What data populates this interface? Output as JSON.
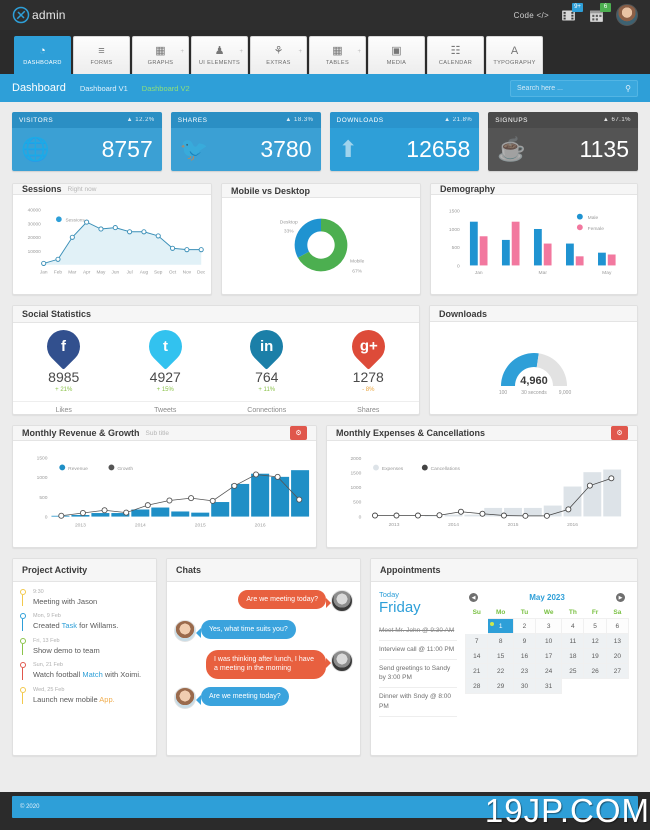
{
  "topbar": {
    "brand": "admin",
    "code_label": "Code </>",
    "video_badge": "9+",
    "calendar_badge": "6",
    "video_icon": "film-icon",
    "calendar_icon": "calendar-icon",
    "avatar_icon": "user-avatar"
  },
  "nav": {
    "tabs": [
      {
        "label": "DASHBOARD",
        "icon": "speedometer-icon",
        "active": true,
        "plus": false
      },
      {
        "label": "FORMS",
        "icon": "list-icon",
        "active": false,
        "plus": false
      },
      {
        "label": "GRAPHS",
        "icon": "bar-chart-icon",
        "active": false,
        "plus": true
      },
      {
        "label": "UI ELEMENTS",
        "icon": "cube-icon",
        "active": false,
        "plus": true
      },
      {
        "label": "EXTRAS",
        "icon": "puzzle-icon",
        "active": false,
        "plus": true
      },
      {
        "label": "TABLES",
        "icon": "table-icon",
        "active": false,
        "plus": true
      },
      {
        "label": "MEDIA",
        "icon": "image-icon",
        "active": false,
        "plus": false
      },
      {
        "label": "CALENDAR",
        "icon": "calendar-icon",
        "active": false,
        "plus": false
      },
      {
        "label": "TYPOGRAPHY",
        "icon": "letter-a-icon",
        "active": false,
        "plus": false
      }
    ]
  },
  "breadcrumb": {
    "title": "Dashboard",
    "items": [
      {
        "label": "Dashboard V1",
        "current": false
      },
      {
        "label": "Dashboard V2",
        "current": true
      }
    ]
  },
  "search": {
    "placeholder": "Search here ...",
    "value": ""
  },
  "stats": [
    {
      "label": "VISITORS",
      "pct": "12.2%",
      "value": "8757",
      "icon": "globe-icon",
      "theme": "blue"
    },
    {
      "label": "SHARES",
      "pct": "18.3%",
      "value": "3780",
      "icon": "twitter-icon",
      "theme": "blue"
    },
    {
      "label": "DOWNLOADS",
      "pct": "21.8%",
      "value": "12658",
      "icon": "upload-icon",
      "theme": "lightblue"
    },
    {
      "label": "SIGNUPS",
      "pct": "67.1%",
      "value": "1135",
      "icon": "coffee-icon",
      "theme": "dark"
    }
  ],
  "panels": {
    "sessions": {
      "title": "Sessions",
      "subtitle": "Right now"
    },
    "mobile_desktop": {
      "title": "Mobile vs Desktop"
    },
    "demography": {
      "title": "Demography"
    },
    "social": {
      "title": "Social Statistics"
    },
    "downloads": {
      "title": "Downloads"
    },
    "revenue": {
      "title": "Monthly Revenue & Growth",
      "subtitle": "Sub title",
      "button_icon": "gear-icon"
    },
    "expenses": {
      "title": "Monthly Expenses & Cancellations",
      "button_icon": "gear-icon"
    },
    "activity": {
      "title": "Project Activity"
    },
    "chats": {
      "title": "Chats"
    },
    "appointments": {
      "title": "Appointments"
    }
  },
  "chart_data": [
    {
      "type": "area",
      "title": "Sessions",
      "subtitle": "Right now",
      "categories": [
        "Jan",
        "Feb",
        "Mar",
        "Apr",
        "May",
        "Jun",
        "Jul",
        "Aug",
        "Sep",
        "Oct",
        "Nov",
        "Dec"
      ],
      "series": [
        {
          "name": "Sessions",
          "values": [
            1000,
            4000,
            20000,
            31000,
            26000,
            27000,
            24000,
            24000,
            21000,
            12000,
            11000,
            11000
          ],
          "color": "#3a8fb7"
        }
      ],
      "ylim": [
        0,
        40000
      ],
      "yticks": [
        10000,
        20000,
        30000,
        40000
      ],
      "xlabel": "",
      "ylabel": "",
      "grid": false,
      "legend": "inside-top-left"
    },
    {
      "type": "pie",
      "title": "Mobile vs Desktop",
      "labels": [
        "Mobile",
        "Desktop"
      ],
      "values": [
        67,
        33
      ],
      "value_labels": [
        "67%",
        "33%"
      ],
      "colors": [
        "#4caf50",
        "#1f93d1"
      ],
      "donut": true,
      "legend": "callout-labels"
    },
    {
      "type": "bar",
      "title": "Demography",
      "categories": [
        "Jan",
        "",
        "Mar",
        "",
        "May"
      ],
      "series": [
        {
          "name": "Male",
          "values": [
            1200,
            700,
            1000,
            600,
            350
          ],
          "color": "#1f93d1"
        },
        {
          "name": "Female",
          "values": [
            800,
            1200,
            600,
            250,
            300
          ],
          "color": "#f2789f"
        }
      ],
      "ylim": [
        0,
        1500
      ],
      "yticks": [
        0,
        500,
        1000,
        1500
      ],
      "xlabel": "",
      "ylabel": "",
      "grid": false,
      "legend": "top-right"
    },
    {
      "type": "gauge",
      "title": "Downloads",
      "value": 4960,
      "value_label": "4,960",
      "min_label": "100",
      "center_label": "30 seconds",
      "max_label": "9,000",
      "ylim": [
        100,
        9000
      ],
      "colors": [
        "#2e9fd8",
        "#e2e2e2"
      ]
    },
    {
      "type": "bar",
      "title": "Monthly Revenue & Growth",
      "subtitle": "Sub title",
      "categories": [
        "2013",
        "",
        "",
        "2014",
        "",
        "",
        "2015",
        "",
        "",
        "2016",
        "",
        ""
      ],
      "series": [
        {
          "name": "Revenue",
          "values": [
            20,
            40,
            90,
            90,
            180,
            230,
            130,
            100,
            370,
            830,
            1090,
            1010,
            1180
          ],
          "color": "#1f8fc6",
          "kind": "bar"
        },
        {
          "name": "Growth",
          "values": [
            20,
            90,
            160,
            100,
            290,
            410,
            470,
            400,
            780,
            1070,
            1010,
            430
          ],
          "color": "#555555",
          "kind": "line"
        }
      ],
      "ylim": [
        0,
        1500
      ],
      "yticks": [
        0,
        500,
        1000,
        1500
      ],
      "xticklabels": [
        "2013",
        "2014",
        "2015",
        "2016"
      ],
      "grid": false,
      "legend": "inside-top-left"
    },
    {
      "type": "bar",
      "title": "Monthly Expenses & Cancellations",
      "categories": [
        "2013",
        "",
        "",
        "2014",
        "",
        "",
        "2015",
        "",
        "",
        "2016",
        "",
        ""
      ],
      "series": [
        {
          "name": "Expenses",
          "values": [
            0,
            0,
            0,
            20,
            60,
            60,
            290,
            290,
            290,
            370,
            1020,
            1510,
            1600
          ],
          "color": "#dde3e8",
          "kind": "bar"
        },
        {
          "name": "Cancellations",
          "values": [
            30,
            30,
            30,
            40,
            160,
            90,
            30,
            20,
            20,
            240,
            1050,
            1300
          ],
          "color": "#444444",
          "kind": "line"
        }
      ],
      "ylim": [
        0,
        2000
      ],
      "yticks": [
        0,
        500,
        1000,
        1500,
        2000
      ],
      "xticklabels": [
        "2013",
        "2014",
        "2015",
        "2016"
      ],
      "grid": false,
      "legend": "inside-top-left"
    }
  ],
  "social": [
    {
      "network": "facebook",
      "icon": "facebook-icon",
      "glyph": "f",
      "color": "#32508e",
      "value": "8985",
      "pct": "+ 21%",
      "dir": "up",
      "label": "Likes"
    },
    {
      "network": "twitter",
      "icon": "twitter-icon",
      "glyph": "t",
      "color": "#32c2ef",
      "value": "4927",
      "pct": "+ 15%",
      "dir": "up",
      "label": "Tweets"
    },
    {
      "network": "linkedin",
      "icon": "linkedin-icon",
      "glyph": "in",
      "color": "#1b7fa8",
      "value": "764",
      "pct": "+ 11%",
      "dir": "up",
      "label": "Connections"
    },
    {
      "network": "google",
      "icon": "google-plus-icon",
      "glyph": "g+",
      "color": "#dd4b39",
      "value": "1278",
      "pct": "- 8%",
      "dir": "down",
      "label": "Shares"
    }
  ],
  "activity": [
    {
      "time": "9:30",
      "text_before": "Meeting with Jason",
      "link": "",
      "text_after": "",
      "color": "#f2c94c"
    },
    {
      "time": "Mon, 9 Feb",
      "text_before": "Created ",
      "link": "Task",
      "text_after": " for Willams.",
      "color": "#2e9fd8"
    },
    {
      "time": "Fri, 13 Feb",
      "text_before": "Show demo to team",
      "link": "",
      "text_after": "",
      "color": "#8bc34a"
    },
    {
      "time": "Sun, 21 Feb",
      "text_before": "Watch football ",
      "link": "Match",
      "text_after": " with Xoimi.",
      "color": "#e0574c"
    },
    {
      "time": "Wed, 25 Feb",
      "text_before": "Launch new mobile ",
      "link": "App.",
      "text_after": "",
      "color": "#f2c94c",
      "link_orange": true
    }
  ],
  "chats": [
    {
      "side": "right",
      "avatar": "male-avatar",
      "text": "Are we meeting today?",
      "color": "orange"
    },
    {
      "side": "left",
      "avatar": "female-avatar",
      "text": "Yes, what time suits you?",
      "color": "blue"
    },
    {
      "side": "right",
      "avatar": "male-avatar",
      "text": "I was thinking after lunch, I have a meeting in the morning",
      "color": "orange"
    },
    {
      "side": "left",
      "avatar": "female-avatar",
      "text": "Are we meeting today?",
      "color": "blue"
    }
  ],
  "appointments": {
    "today_label": "Today",
    "day": "Friday",
    "items": [
      {
        "text": "Meet Mr. John @ 9:30 AM",
        "done": true
      },
      {
        "text": "Interview call @ 11:00 PM",
        "done": false
      },
      {
        "text": "Send greetings to Sandy by 3:00 PM",
        "done": false
      },
      {
        "text": "Dinner with Sndy @ 8:00 PM",
        "done": false
      }
    ],
    "calendar": {
      "month": "May 2023",
      "prev_icon": "chevron-left-icon",
      "next_icon": "chevron-right-icon",
      "weekdays": [
        "Su",
        "Mo",
        "Tu",
        "We",
        "Th",
        "Fr",
        "Sa"
      ],
      "weeks": [
        [
          "",
          "1",
          "2",
          "3",
          "4",
          "5",
          "6"
        ],
        [
          "7",
          "8",
          "9",
          "10",
          "11",
          "12",
          "13"
        ],
        [
          "14",
          "15",
          "16",
          "17",
          "18",
          "19",
          "20"
        ],
        [
          "21",
          "22",
          "23",
          "24",
          "25",
          "26",
          "27"
        ],
        [
          "28",
          "29",
          "30",
          "31",
          "",
          "",
          ""
        ]
      ],
      "selected": "1"
    }
  },
  "footer": {
    "copyright": "© 2020"
  },
  "watermark": "19JP.COM"
}
